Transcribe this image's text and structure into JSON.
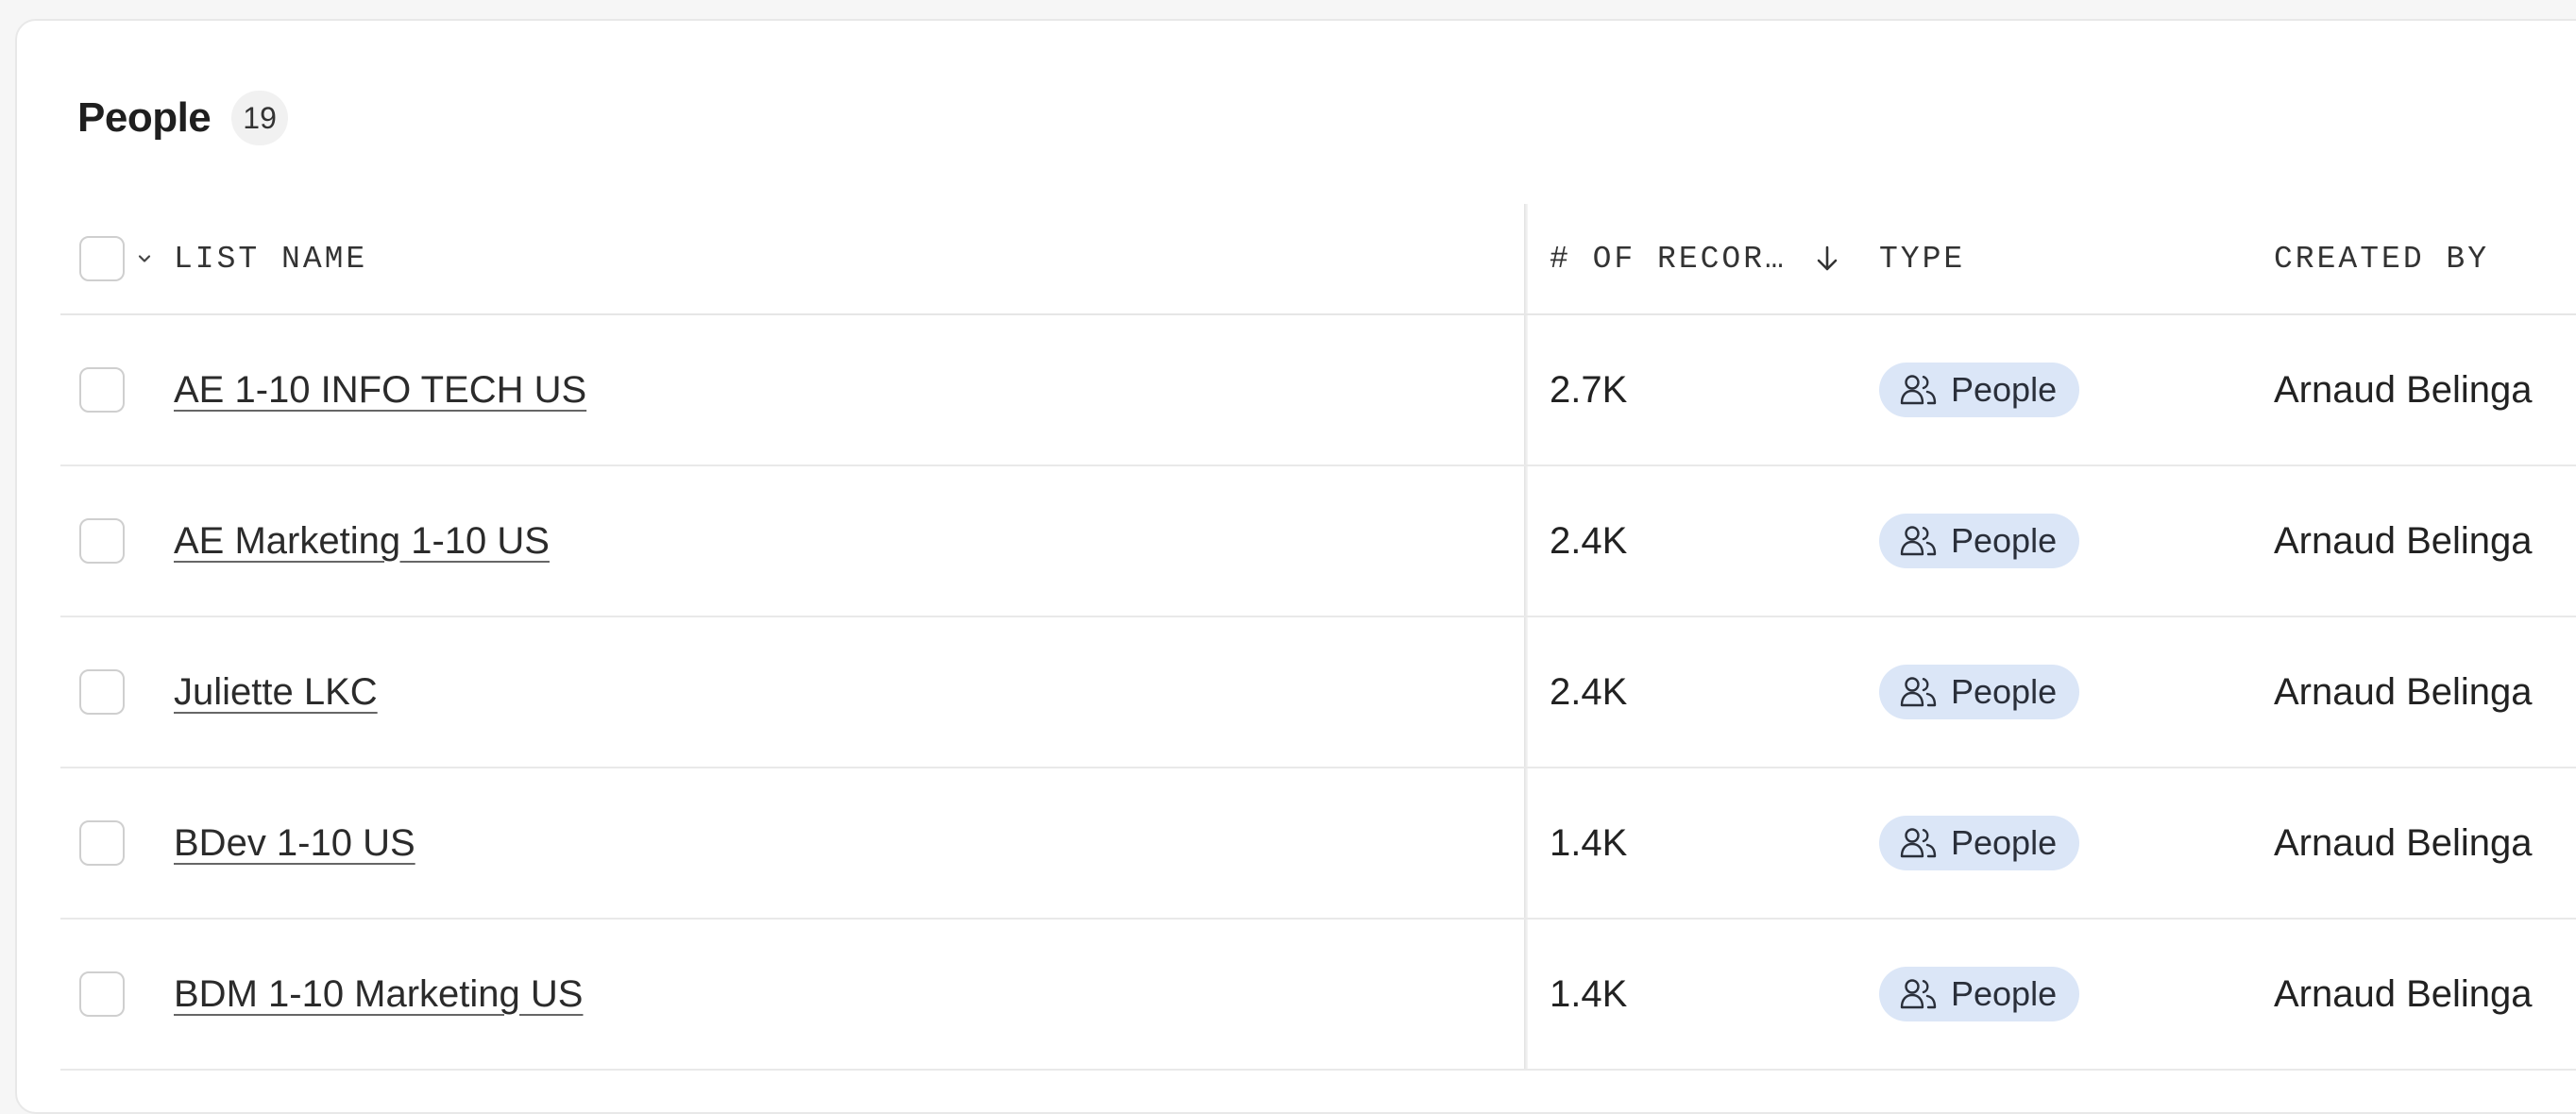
{
  "header": {
    "title": "People",
    "count": "19"
  },
  "columns": {
    "list_name": "LIST NAME",
    "records": "# OF RECOR…",
    "type": "TYPE",
    "created_by": "CREATED BY"
  },
  "icons": {
    "select_all_chevron": "chevron-down-icon",
    "sort": "arrow-down-icon",
    "type": "people-icon"
  },
  "colors": {
    "type_pill_bg": "#dbe6f7"
  },
  "rows": [
    {
      "name": "AE 1-10 INFO TECH US",
      "records": "2.7K",
      "type": "People",
      "created_by": "Arnaud Belinga"
    },
    {
      "name": "AE Marketing 1-10 US",
      "records": "2.4K",
      "type": "People",
      "created_by": "Arnaud Belinga"
    },
    {
      "name": "Juliette LKC",
      "records": "2.4K",
      "type": "People",
      "created_by": "Arnaud Belinga"
    },
    {
      "name": "BDev 1-10 US",
      "records": "1.4K",
      "type": "People",
      "created_by": "Arnaud Belinga"
    },
    {
      "name": "BDM 1-10 Marketing US",
      "records": "1.4K",
      "type": "People",
      "created_by": "Arnaud Belinga"
    }
  ]
}
